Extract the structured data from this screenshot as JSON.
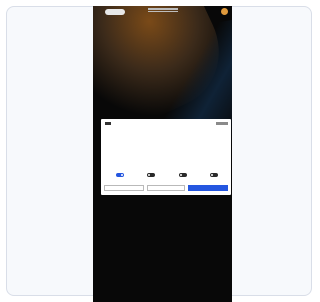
{
  "colors": {
    "card_border": "#d9dee8",
    "card_bg": "#f7f9fc",
    "phone_bg": "#080808",
    "accent_orange": "#e09a3c",
    "primary_blue": "#2456e0"
  },
  "header": {
    "brand_icon": "pill-logo",
    "logo_text": "",
    "avatar_icon": "avatar-icon"
  },
  "consent": {
    "title": "",
    "body": "",
    "toggles": [
      {
        "label": "",
        "on": true
      },
      {
        "label": "",
        "on": false
      },
      {
        "label": "",
        "on": false
      },
      {
        "label": "",
        "on": false
      }
    ],
    "details_link": "",
    "buttons": {
      "deny": "",
      "allow_selection": "",
      "allow_all": ""
    }
  }
}
